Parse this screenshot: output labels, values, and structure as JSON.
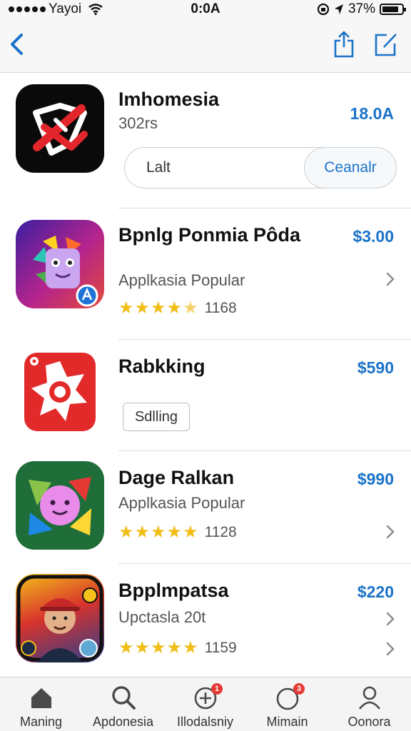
{
  "status_bar": {
    "carrier": "Yayoi",
    "time": "0:0A",
    "battery": "37%"
  },
  "nav": {
    "back_icon": "chevron-left-icon",
    "share_icon": "share-icon",
    "compose_icon": "compose-icon",
    "accent_color": "#1a73c8"
  },
  "apps": [
    {
      "title": "Imhomesia",
      "subtitle": "302rs",
      "price": "18.0A",
      "segment_left": "Lalt",
      "segment_right": "Ceanalr",
      "icon": "red-arrow-logo-icon"
    },
    {
      "title": "Bpnlg Ponmia Pôda",
      "subtitle": "Applkasia Popular",
      "price": "$3.00",
      "rating_count": "1168",
      "rating": 4.5,
      "icon": "colorful-monster-icon"
    },
    {
      "title": "Rabkking",
      "price": "$590",
      "button_label": "Sdlling",
      "icon": "red-gear-icon"
    },
    {
      "title": "Dage Ralkan",
      "subtitle": "Applkasia Popular",
      "price": "$990",
      "rating_count": "1128",
      "rating": 5,
      "icon": "green-puzzle-face-icon"
    },
    {
      "title": "Bpplmpatsa",
      "subtitle": "Upctasla 20t",
      "price": "$220",
      "rating_count": "1159",
      "rating": 5,
      "icon": "person-hat-poster-icon"
    }
  ],
  "tabs": [
    {
      "label": "Maning",
      "icon": "home-icon"
    },
    {
      "label": "Apdonesia",
      "icon": "search-icon"
    },
    {
      "label": "Illodalsniy",
      "icon": "add-circle-icon",
      "badge": "1"
    },
    {
      "label": "Mimain",
      "icon": "circle-icon",
      "badge": "3"
    },
    {
      "label": "Oonora",
      "icon": "person-icon"
    }
  ]
}
